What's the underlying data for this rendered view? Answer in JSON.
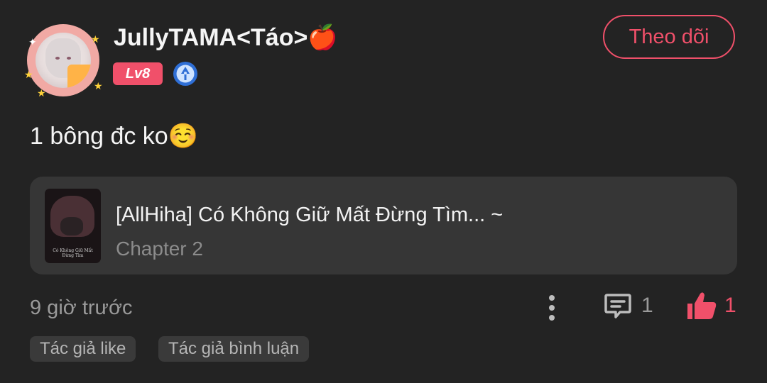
{
  "user": {
    "name": "JullyTAMA<Táo>🍎",
    "level_badge": "Lv8",
    "follow_label": "Theo dõi"
  },
  "comment": {
    "text": "1 bông đc ko☺️"
  },
  "story": {
    "title": "[AllHiha] Có Không Giữ Mất Đừng Tìm... ~",
    "chapter": "Chapter 2",
    "cover_caption": "Có Không Giữ Mất Đừng Tìm"
  },
  "meta": {
    "timestamp": "9 giờ trước",
    "comment_count": "1",
    "like_count": "1"
  },
  "tags": {
    "author_like": "Tác giả like",
    "author_comment": "Tác giả bình luận"
  },
  "icons": {
    "verify": "verified-badge-icon",
    "more": "more-vertical-icon",
    "comment": "comment-icon",
    "like": "thumbs-up-icon"
  },
  "colors": {
    "background": "#232323",
    "accent": "#f0506a",
    "card": "#363636",
    "muted": "#9a9a9a"
  }
}
